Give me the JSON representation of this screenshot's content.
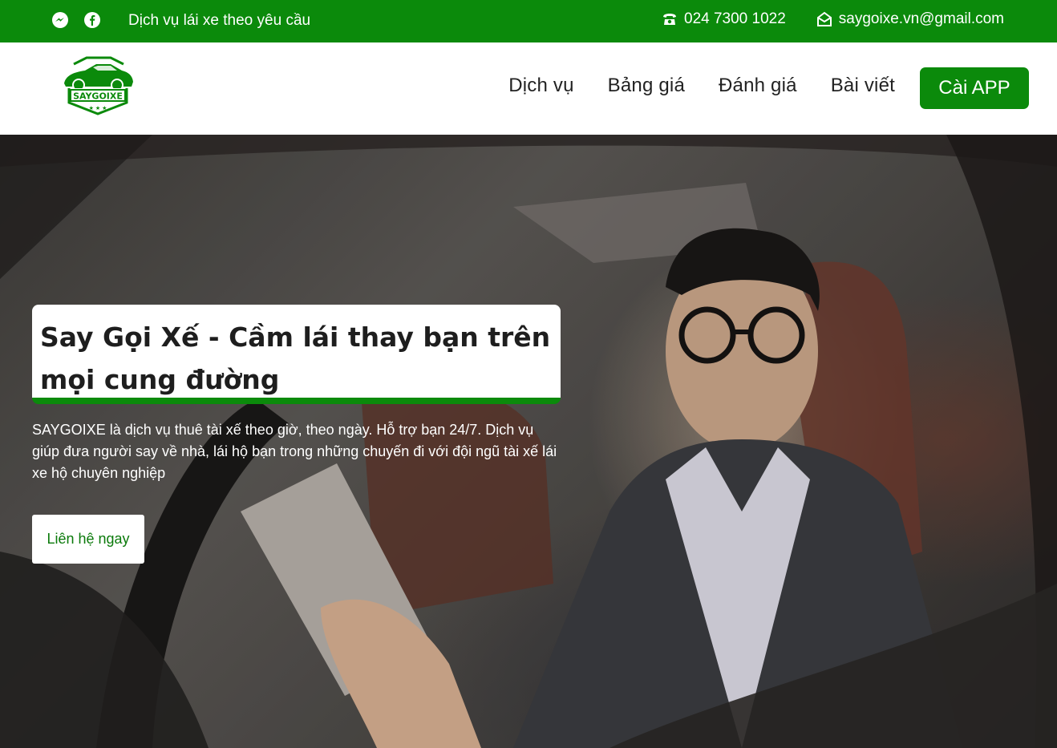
{
  "topbar": {
    "tagline": "Dịch vụ lái xe theo yêu cầu",
    "phone": "024 7300 1022",
    "email": "saygoixe.vn@gmail.com",
    "icons": [
      "messenger-icon",
      "facebook-icon",
      "phone-icon",
      "envelope-icon"
    ]
  },
  "header": {
    "logo_text": "SAYGOIXE",
    "nav": [
      {
        "label": "Dịch vụ"
      },
      {
        "label": "Bảng giá"
      },
      {
        "label": "Đánh giá"
      },
      {
        "label": "Bài viết"
      }
    ],
    "app_button": "Cài APP"
  },
  "hero": {
    "title": "Say Gọi Xế - Cầm lái thay bạn trên mọi cung đường",
    "description": "SAYGOIXE là dịch vụ thuê tài xế theo giờ, theo ngày. Hỗ trợ bạn 24/7. Dịch vụ giúp đưa người say về nhà, lái hộ bạn trong những chuyến đi với đội ngũ tài xế lái xe hộ chuyên nghiệp",
    "cta": "Liên hệ ngay"
  },
  "colors": {
    "brand_green": "#0b8a0b",
    "text_dark": "#1e1e1e"
  }
}
